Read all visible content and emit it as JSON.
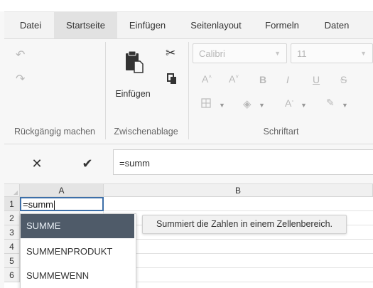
{
  "tabs": [
    "Datei",
    "Startseite",
    "Einfügen",
    "Seitenlayout",
    "Formeln",
    "Daten"
  ],
  "active_tab": "Startseite",
  "ribbon": {
    "undo_group_label": "Rückgängig machen",
    "clipboard_group_label": "Zwischenablage",
    "paste_label": "Einfügen",
    "font_group_label": "Schriftart",
    "font_name": "Calibri",
    "font_size": "11",
    "bold_glyph": "B",
    "italic_glyph": "I",
    "underline_glyph": "U",
    "strike_glyph": "S"
  },
  "formula_bar": {
    "value": "=summ"
  },
  "grid": {
    "columns": [
      "A",
      "B"
    ],
    "rows": [
      "1",
      "2",
      "3",
      "4",
      "5",
      "6"
    ],
    "active_cell": "A1",
    "active_cell_value": "=summ"
  },
  "autocomplete": {
    "items": [
      "SUMME",
      "SUMMENPRODUKT",
      "SUMMEWENN"
    ],
    "selected_index": 0,
    "tooltip": "Summiert die Zahlen in einem Zellenbereich."
  },
  "colors": {
    "selected_item_bg": "#4f5b69",
    "active_cell_border": "#3d6fa8"
  }
}
